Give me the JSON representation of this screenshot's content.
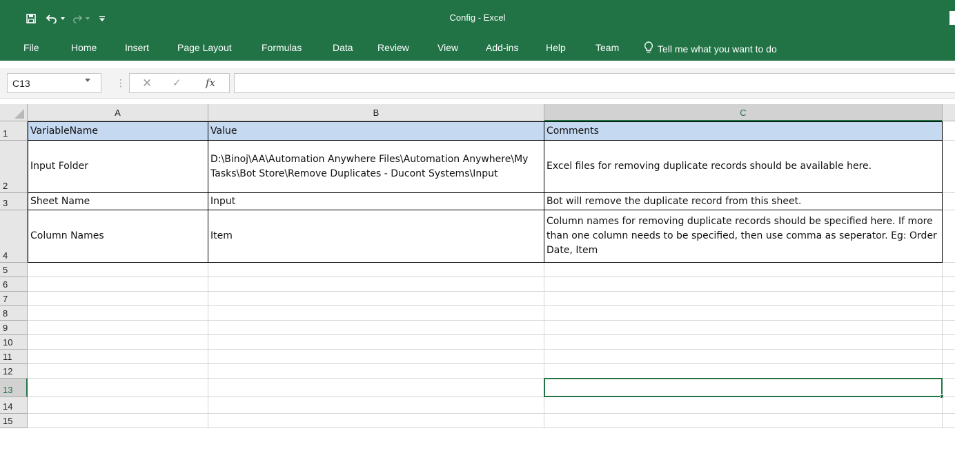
{
  "window": {
    "title": "Config - Excel",
    "accent_color": "#217346"
  },
  "ribbon": {
    "tabs": [
      "File",
      "Home",
      "Insert",
      "Page Layout",
      "Formulas",
      "Data",
      "Review",
      "View",
      "Add-ins",
      "Help",
      "Team"
    ],
    "tell_me": "Tell me what you want to do"
  },
  "formula_bar": {
    "name_box": "C13",
    "fx_label": "fx",
    "formula": ""
  },
  "sheet": {
    "columns": [
      "A",
      "B",
      "C"
    ],
    "selected_column": "C",
    "selected_row": "13",
    "selected_cell": "C13",
    "rows": [
      {
        "num": "1",
        "cells": [
          "VariableName",
          "Value",
          "Comments"
        ]
      },
      {
        "num": "2",
        "cells": [
          "Input Folder",
          "D:\\Binoj\\AA\\Automation Anywhere Files\\Automation Anywhere\\My Tasks\\Bot Store\\Remove Duplicates - Ducont Systems\\Input",
          "Excel files for removing duplicate records should be available here."
        ]
      },
      {
        "num": "3",
        "cells": [
          "Sheet Name",
          "Input",
          "Bot will remove the duplicate record from this sheet."
        ]
      },
      {
        "num": "4",
        "cells": [
          "Column Names",
          "Item",
          "Column names for removing duplicate records should be specified here. If more than one column needs to be specified, then use comma as seperator. Eg: Order Date, Item"
        ]
      },
      {
        "num": "5",
        "cells": [
          "",
          "",
          ""
        ]
      },
      {
        "num": "6",
        "cells": [
          "",
          "",
          ""
        ]
      },
      {
        "num": "7",
        "cells": [
          "",
          "",
          ""
        ]
      },
      {
        "num": "8",
        "cells": [
          "",
          "",
          ""
        ]
      },
      {
        "num": "9",
        "cells": [
          "",
          "",
          ""
        ]
      },
      {
        "num": "10",
        "cells": [
          "",
          "",
          ""
        ]
      },
      {
        "num": "11",
        "cells": [
          "",
          "",
          ""
        ]
      },
      {
        "num": "12",
        "cells": [
          "",
          "",
          ""
        ]
      },
      {
        "num": "13",
        "cells": [
          "",
          "",
          ""
        ]
      },
      {
        "num": "14",
        "cells": [
          "",
          "",
          ""
        ]
      },
      {
        "num": "15",
        "cells": [
          "",
          "",
          ""
        ]
      }
    ]
  }
}
